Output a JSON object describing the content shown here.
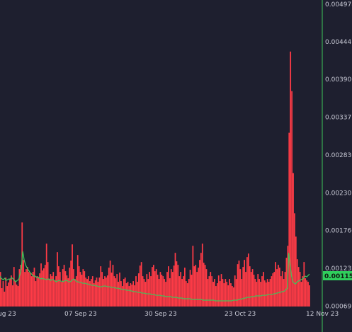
{
  "chart_data": {
    "type": "bar",
    "title": "",
    "xlabel": "",
    "ylabel": "",
    "ylim": [
      0.00069,
      0.00498
    ],
    "y_ticks": [
      "0.004978",
      "0.00444",
      "0.003906",
      "0.003371",
      "0.002836",
      "0.002301",
      "0.001766",
      "0.001232",
      "0.000697"
    ],
    "x_ticks": [
      "ug 23",
      "07 Sep 23",
      "30 Sep 23",
      "23 Oct 23",
      "12 Nov 23"
    ],
    "current_price_label": "0.001152",
    "grid": false,
    "series": [
      {
        "type": "bar",
        "color": "#ff3b46",
        "values": [
          0.00098,
          0.00115,
          0.00102,
          0.00118,
          0.00095,
          0.00105,
          0.0009,
          0.0011,
          0.00098,
          0.00103,
          0.00108,
          0.00113,
          0.00099,
          0.00125,
          0.00105,
          0.001,
          0.00098,
          0.00122,
          0.00128,
          0.00188,
          0.00135,
          0.00118,
          0.00122,
          0.00125,
          0.00118,
          0.00116,
          0.00112,
          0.00118,
          0.00124,
          0.00105,
          0.00112,
          0.0011,
          0.00116,
          0.0013,
          0.0012,
          0.00123,
          0.00128,
          0.00158,
          0.00132,
          0.00108,
          0.00115,
          0.00112,
          0.00118,
          0.00106,
          0.00112,
          0.00146,
          0.00126,
          0.00118,
          0.00104,
          0.00122,
          0.00128,
          0.00119,
          0.00113,
          0.00109,
          0.00124,
          0.00134,
          0.00157,
          0.00122,
          0.00108,
          0.00112,
          0.00142,
          0.00126,
          0.00118,
          0.00114,
          0.00122,
          0.00119,
          0.0011,
          0.00108,
          0.00112,
          0.00105,
          0.00108,
          0.00112,
          0.00102,
          0.00106,
          0.0011,
          0.00104,
          0.0011,
          0.00126,
          0.00118,
          0.00108,
          0.00112,
          0.0011,
          0.00113,
          0.00124,
          0.00134,
          0.00117,
          0.00128,
          0.00112,
          0.00109,
          0.00115,
          0.00104,
          0.00117,
          0.00105,
          0.00098,
          0.00108,
          0.0011,
          0.00102,
          0.00104,
          0.00098,
          0.00102,
          0.001,
          0.00105,
          0.00099,
          0.00112,
          0.00104,
          0.00116,
          0.00127,
          0.00132,
          0.00112,
          0.00108,
          0.00104,
          0.00115,
          0.00108,
          0.00118,
          0.00112,
          0.00125,
          0.00128,
          0.00119,
          0.00122,
          0.00114,
          0.00108,
          0.00118,
          0.00114,
          0.00112,
          0.00108,
          0.00104,
          0.00118,
          0.00126,
          0.00109,
          0.00122,
          0.00118,
          0.00127,
          0.00145,
          0.00133,
          0.00128,
          0.00112,
          0.00118,
          0.00108,
          0.00112,
          0.00124,
          0.00105,
          0.00102,
          0.00108,
          0.00121,
          0.00114,
          0.00155,
          0.00126,
          0.00128,
          0.00118,
          0.00124,
          0.00135,
          0.00145,
          0.00158,
          0.00131,
          0.00128,
          0.00122,
          0.00108,
          0.00112,
          0.00118,
          0.00112,
          0.00104,
          0.00108,
          0.00098,
          0.00102,
          0.00113,
          0.00105,
          0.00115,
          0.00108,
          0.00102,
          0.00108,
          0.00104,
          0.00099,
          0.00108,
          0.00102,
          0.00098,
          0.00096,
          0.00113,
          0.00108,
          0.00129,
          0.00134,
          0.00122,
          0.00108,
          0.00125,
          0.00135,
          0.00118,
          0.00139,
          0.00144,
          0.00126,
          0.00118,
          0.00122,
          0.00114,
          0.00108,
          0.00104,
          0.00115,
          0.00108,
          0.00104,
          0.00112,
          0.00118,
          0.00106,
          0.00103,
          0.00108,
          0.00104,
          0.00108,
          0.00112,
          0.00116,
          0.00118,
          0.00132,
          0.00122,
          0.00128,
          0.00124,
          0.00112,
          0.00119,
          0.00108,
          0.00118,
          0.00138,
          0.00155,
          0.00315,
          0.0043,
          0.00374,
          0.00258,
          0.00201,
          0.00168,
          0.00136,
          0.00125,
          0.00118,
          0.00104,
          0.00112,
          0.00132,
          0.00109,
          0.00106,
          0.00104,
          0.00099
        ]
      },
      {
        "type": "line",
        "color": "#3ec65a",
        "values": [
          0.00115,
          0.00112,
          0.00114,
          0.0011,
          0.00108,
          0.00107,
          0.00109,
          0.00106,
          0.00107,
          0.00108,
          0.00108,
          0.0011,
          0.00108,
          0.00106,
          0.00104,
          0.00106,
          0.00107,
          0.00115,
          0.00123,
          0.00147,
          0.00135,
          0.00128,
          0.00124,
          0.00121,
          0.00118,
          0.00116,
          0.00113,
          0.00112,
          0.00112,
          0.0011,
          0.00111,
          0.00109,
          0.00108,
          0.00109,
          0.00108,
          0.00108,
          0.00107,
          0.00108,
          0.00108,
          0.00106,
          0.00107,
          0.00107,
          0.00106,
          0.00104,
          0.00105,
          0.00106,
          0.00105,
          0.00105,
          0.00104,
          0.00105,
          0.00106,
          0.00106,
          0.00104,
          0.00104,
          0.00105,
          0.00107,
          0.00108,
          0.00106,
          0.00104,
          0.00104,
          0.00103,
          0.00103,
          0.00102,
          0.00102,
          0.00102,
          0.00101,
          0.00101,
          0.001,
          0.001,
          0.00099,
          0.00099,
          0.00099,
          0.00098,
          0.00098,
          0.00097,
          0.00097,
          0.00097,
          0.00098,
          0.00098,
          0.00098,
          0.00097,
          0.00097,
          0.00097,
          0.00096,
          0.00096,
          0.00096,
          0.00095,
          0.00095,
          0.00095,
          0.00094,
          0.00094,
          0.00093,
          0.00093,
          0.00093,
          0.00092,
          0.00092,
          0.00092,
          0.00091,
          0.00091,
          0.0009,
          0.0009,
          0.0009,
          0.00089,
          0.00089,
          0.00089,
          0.00088,
          0.00088,
          0.00088,
          0.00087,
          0.00087,
          0.00087,
          0.00087,
          0.00086,
          0.00086,
          0.00086,
          0.00085,
          0.00085,
          0.00085,
          0.00085,
          0.00084,
          0.00084,
          0.00084,
          0.00083,
          0.00083,
          0.00083,
          0.00083,
          0.00083,
          0.00082,
          0.00082,
          0.00082,
          0.00082,
          0.00081,
          0.00081,
          0.00081,
          0.00081,
          0.0008,
          0.0008,
          0.0008,
          0.0008,
          0.0008,
          0.0008,
          0.00079,
          0.00079,
          0.00079,
          0.00079,
          0.00079,
          0.00079,
          0.00079,
          0.00079,
          0.00078,
          0.00078,
          0.00078,
          0.00078,
          0.00078,
          0.00078,
          0.00078,
          0.00078,
          0.00078,
          0.00077,
          0.00077,
          0.00077,
          0.00077,
          0.00077,
          0.00077,
          0.00077,
          0.00077,
          0.00077,
          0.00077,
          0.00077,
          0.00077,
          0.00077,
          0.00078,
          0.00078,
          0.00078,
          0.00078,
          0.00079,
          0.00079,
          0.0008,
          0.0008,
          0.00081,
          0.00081,
          0.00082,
          0.00082,
          0.00082,
          0.00083,
          0.00083,
          0.00083,
          0.00084,
          0.00084,
          0.00084,
          0.00084,
          0.00084,
          0.00085,
          0.00085,
          0.00085,
          0.00085,
          0.00086,
          0.00086,
          0.00086,
          0.00086,
          0.00087,
          0.00087,
          0.00088,
          0.00088,
          0.00089,
          0.00089,
          0.0009,
          0.0009,
          0.00091,
          0.00093,
          0.00095,
          0.00145,
          0.00128,
          0.00112,
          0.00104,
          0.00102,
          0.00101,
          0.00104,
          0.00105,
          0.00106,
          0.00107,
          0.00108,
          0.0011,
          0.00112,
          0.00111,
          0.00113,
          0.00115
        ]
      }
    ]
  }
}
